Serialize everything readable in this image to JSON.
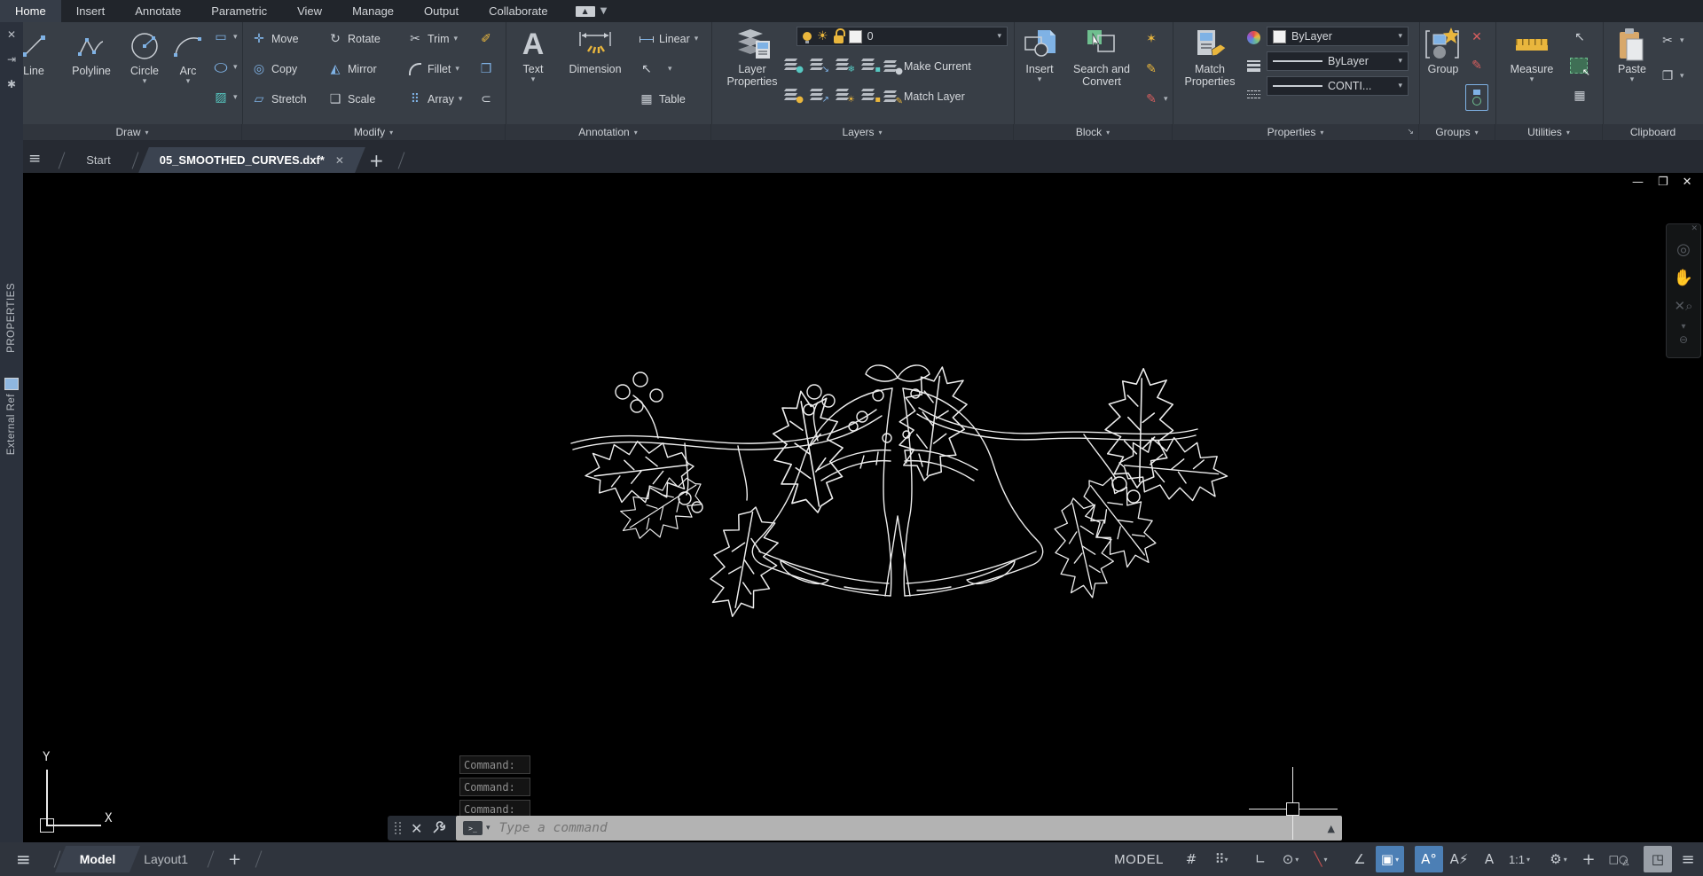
{
  "menu": {
    "tabs": [
      "Home",
      "Insert",
      "Annotate",
      "Parametric",
      "View",
      "Manage",
      "Output",
      "Collaborate"
    ]
  },
  "ribbon": {
    "draw": {
      "label": "Draw",
      "line": "Line",
      "polyline": "Polyline",
      "circle": "Circle",
      "arc": "Arc"
    },
    "modify": {
      "label": "Modify",
      "move": "Move",
      "rotate": "Rotate",
      "trim": "Trim",
      "copy": "Copy",
      "mirror": "Mirror",
      "fillet": "Fillet",
      "stretch": "Stretch",
      "scale": "Scale",
      "array": "Array"
    },
    "annotation": {
      "label": "Annotation",
      "text": "Text",
      "dimension": "Dimension",
      "linear": "Linear",
      "table": "Table"
    },
    "layers": {
      "label": "Layers",
      "layer_properties": "Layer\nProperties",
      "current_layer": "0",
      "make_current": "Make Current",
      "match_layer": "Match Layer"
    },
    "block": {
      "label": "Block",
      "insert": "Insert",
      "search_convert": "Search and\nConvert"
    },
    "properties": {
      "label": "Properties",
      "match_properties": "Match\nProperties",
      "color": "ByLayer",
      "lineweight": "ByLayer",
      "linetype": "CONTI..."
    },
    "groups": {
      "label": "Groups",
      "group": "Group"
    },
    "utilities": {
      "label": "Utilities",
      "measure": "Measure"
    },
    "clipboard": {
      "label": "Clipboard",
      "paste": "Paste"
    }
  },
  "file_tabs": {
    "start": "Start",
    "drawing": "05_SMOOTHED_CURVES.dxf*"
  },
  "palettes": {
    "properties": "PROPERTIES",
    "external_ref": "External Ref"
  },
  "ucs": {
    "x": "X",
    "y": "Y"
  },
  "command": {
    "history1": "Command:",
    "history2": "Command:",
    "history3": "Command:",
    "placeholder": "Type a command"
  },
  "statusbar": {
    "model_tab": "Model",
    "layout_tab": "Layout1",
    "model_badge": "MODEL",
    "annotation_scale": "1:1"
  },
  "colors": {
    "accent_blue": "#7fb2e5",
    "accent_yellow": "#e9b63d",
    "canvas_bg": "#000000",
    "ribbon_bg": "#383e46",
    "command_bar": "#b3b3b3",
    "status_active_blue": "#4c7fb5"
  }
}
